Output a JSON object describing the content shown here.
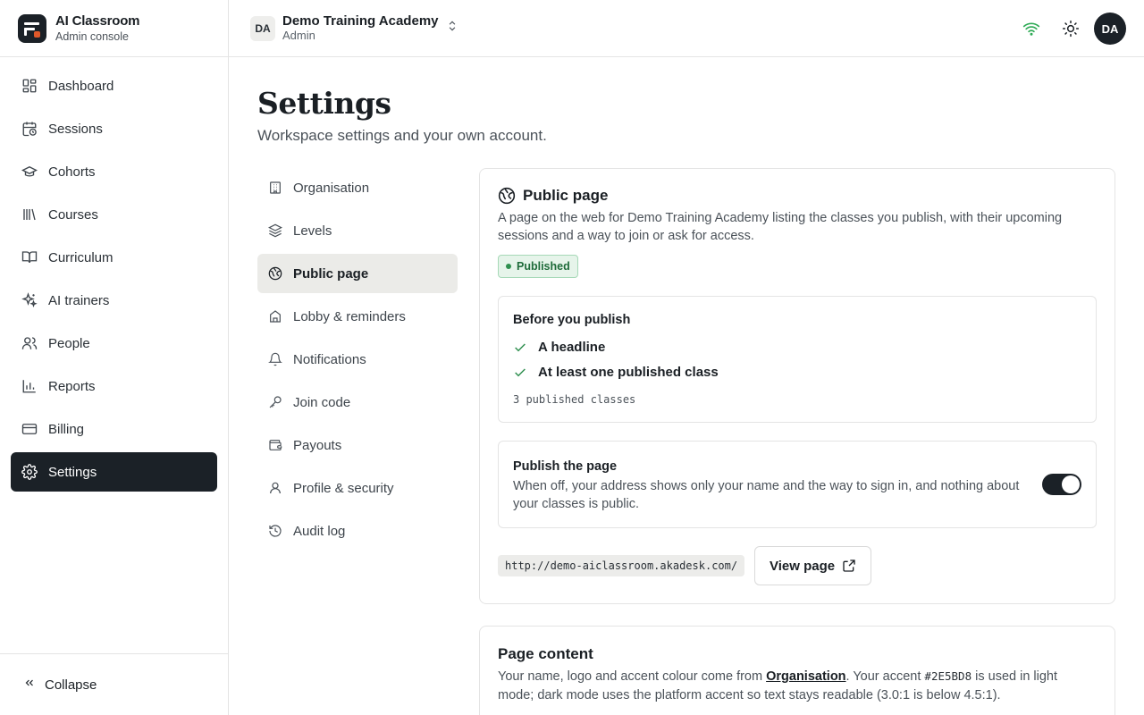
{
  "brand": {
    "title": "AI Classroom",
    "subtitle": "Admin console"
  },
  "sidebar": {
    "items": [
      {
        "label": "Dashboard",
        "icon": "dashboard-icon",
        "active": false
      },
      {
        "label": "Sessions",
        "icon": "calendar-clock-icon",
        "active": false
      },
      {
        "label": "Cohorts",
        "icon": "graduation-cap-icon",
        "active": false
      },
      {
        "label": "Courses",
        "icon": "library-icon",
        "active": false
      },
      {
        "label": "Curriculum",
        "icon": "book-open-icon",
        "active": false
      },
      {
        "label": "AI trainers",
        "icon": "sparkles-icon",
        "active": false
      },
      {
        "label": "People",
        "icon": "users-icon",
        "active": false
      },
      {
        "label": "Reports",
        "icon": "bar-chart-icon",
        "active": false
      },
      {
        "label": "Billing",
        "icon": "credit-card-icon",
        "active": false
      },
      {
        "label": "Settings",
        "icon": "gear-icon",
        "active": true
      }
    ],
    "collapse_label": "Collapse"
  },
  "topbar": {
    "org_initials": "DA",
    "org_name": "Demo Training Academy",
    "org_role": "Admin",
    "avatar_initials": "DA",
    "connection_color": "#2eaa55"
  },
  "page": {
    "title": "Settings",
    "subtitle": "Workspace settings and your own account."
  },
  "subnav": {
    "items": [
      {
        "label": "Organisation",
        "icon": "building-icon",
        "active": false
      },
      {
        "label": "Levels",
        "icon": "layers-icon",
        "active": false
      },
      {
        "label": "Public page",
        "icon": "globe-icon",
        "active": true
      },
      {
        "label": "Lobby & reminders",
        "icon": "lobby-icon",
        "active": false
      },
      {
        "label": "Notifications",
        "icon": "bell-icon",
        "active": false
      },
      {
        "label": "Join code",
        "icon": "key-icon",
        "active": false
      },
      {
        "label": "Payouts",
        "icon": "wallet-icon",
        "active": false
      },
      {
        "label": "Profile & security",
        "icon": "user-icon",
        "active": false
      },
      {
        "label": "Audit log",
        "icon": "history-icon",
        "active": false
      }
    ]
  },
  "public_page": {
    "title": "Public page",
    "description": "A page on the web for Demo Training Academy listing the classes you publish, with their upcoming sessions and a way to join or ask for access.",
    "status_badge": "Published",
    "checklist": {
      "title": "Before you publish",
      "items": [
        "A headline",
        "At least one published class"
      ],
      "note": "3 published classes"
    },
    "publish_toggle": {
      "title": "Publish the page",
      "description": "When off, your address shows only your name and the way to sign in, and nothing about your classes is public.",
      "on": true
    },
    "url": "http://demo-aiclassroom.akadesk.com/",
    "view_button": "View page"
  },
  "page_content": {
    "title": "Page content",
    "desc_prefix": "Your name, logo and accent colour come from ",
    "desc_link": "Organisation",
    "desc_mid": ". Your accent ",
    "accent_code": "#2E5BD8",
    "desc_suffix": " is used in light mode; dark mode uses the platform accent so text stays readable (3.0:1 is below 4.5:1)."
  },
  "colors": {
    "sidebar_active_bg": "#1b2127",
    "published_green": "#2f8f4f",
    "accent": "#2E5BD8"
  }
}
